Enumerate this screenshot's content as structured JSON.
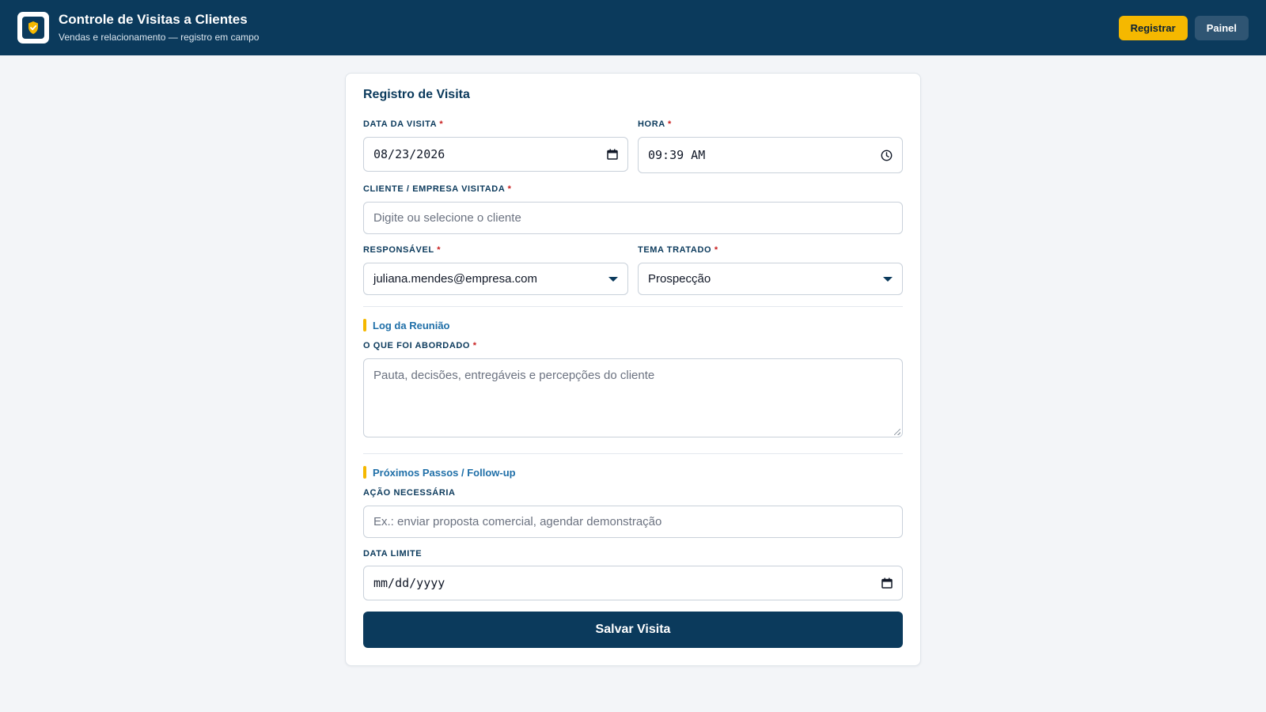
{
  "header": {
    "title": "Controle de Visitas a Clientes",
    "subtitle": "Vendas e relacionamento — registro em campo",
    "logo_icon": "shield-check-icon",
    "actions": {
      "register": "Registrar",
      "panel": "Painel"
    }
  },
  "form": {
    "title": "Registro de Visita",
    "required_mark": "*",
    "visit_date": {
      "label": "DATA DA VISITA",
      "value": "08/23/2026",
      "icon": "calendar-icon"
    },
    "time": {
      "label": "HORA",
      "value": "09:39 AM",
      "icon": "clock-icon"
    },
    "client": {
      "label": "CLIENTE / EMPRESA VISITADA",
      "placeholder": "Digite ou selecione o cliente"
    },
    "responsible": {
      "label": "RESPONSÁVEL",
      "value": "juliana.mendes@empresa.com"
    },
    "topic": {
      "label": "TEMA TRATADO",
      "value": "Prospecção"
    },
    "meeting_log": {
      "section_title": "Log da Reunião",
      "discussed": {
        "label": "O QUE FOI ABORDADO",
        "placeholder": "Pauta, decisões, entregáveis e percepções do cliente"
      }
    },
    "next_steps": {
      "section_title": "Próximos Passos / Follow-up",
      "action": {
        "label": "AÇÃO NECESSÁRIA",
        "placeholder": "Ex.: enviar proposta comercial, agendar demonstração"
      },
      "deadline": {
        "label": "DATA LIMITE",
        "placeholder": "mm/dd/yyyy",
        "icon": "calendar-icon"
      }
    },
    "save_label": "Salvar Visita"
  },
  "colors": {
    "header_bg": "#0b3a5c",
    "accent": "#f5b800",
    "section_title": "#1f6fa8",
    "required": "#c81e1e"
  }
}
